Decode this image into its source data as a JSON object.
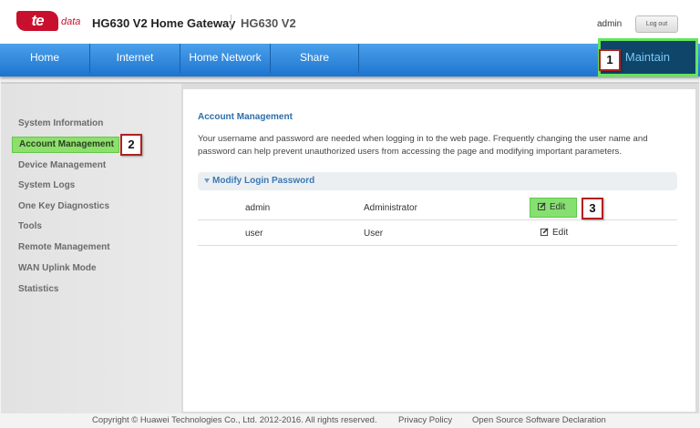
{
  "header": {
    "logo_main": "te",
    "logo_sub": "data",
    "title": "HG630 V2 Home Gateway",
    "model": "HG630 V2",
    "username": "admin",
    "logout_label": "Log out"
  },
  "nav": {
    "items": [
      "Home",
      "Internet",
      "Home Network",
      "Share"
    ],
    "active": "Maintain"
  },
  "callouts": [
    "1",
    "2",
    "3"
  ],
  "sidebar": {
    "items": [
      "System Information",
      "Account Management",
      "Device Management",
      "System Logs",
      "One Key Diagnostics",
      "Tools",
      "Remote Management",
      "WAN Uplink Mode",
      "Statistics"
    ],
    "active_index": 1
  },
  "content": {
    "title": "Account Management",
    "description": "Your username and password are needed when logging in to the web page. Frequently changing the user name and password can help prevent unauthorized users from accessing the page and modifying important parameters.",
    "section_title": "Modify Login Password",
    "accounts": [
      {
        "username": "admin",
        "role": "Administrator",
        "action": "Edit"
      },
      {
        "username": "user",
        "role": "User",
        "action": "Edit"
      }
    ]
  },
  "footer": {
    "copyright": "Copyright © Huawei Technologies Co., Ltd. 2012-2016. All rights reserved.",
    "privacy": "Privacy Policy",
    "oss": "Open Source Software Declaration"
  },
  "colors": {
    "brand_red": "#c8102e",
    "nav_blue": "#2b86db",
    "highlight_green": "#86e070",
    "callout_border": "#b02020",
    "link_blue": "#2c6ea8"
  },
  "icons": [
    "edit-icon",
    "chevron-down-icon"
  ]
}
